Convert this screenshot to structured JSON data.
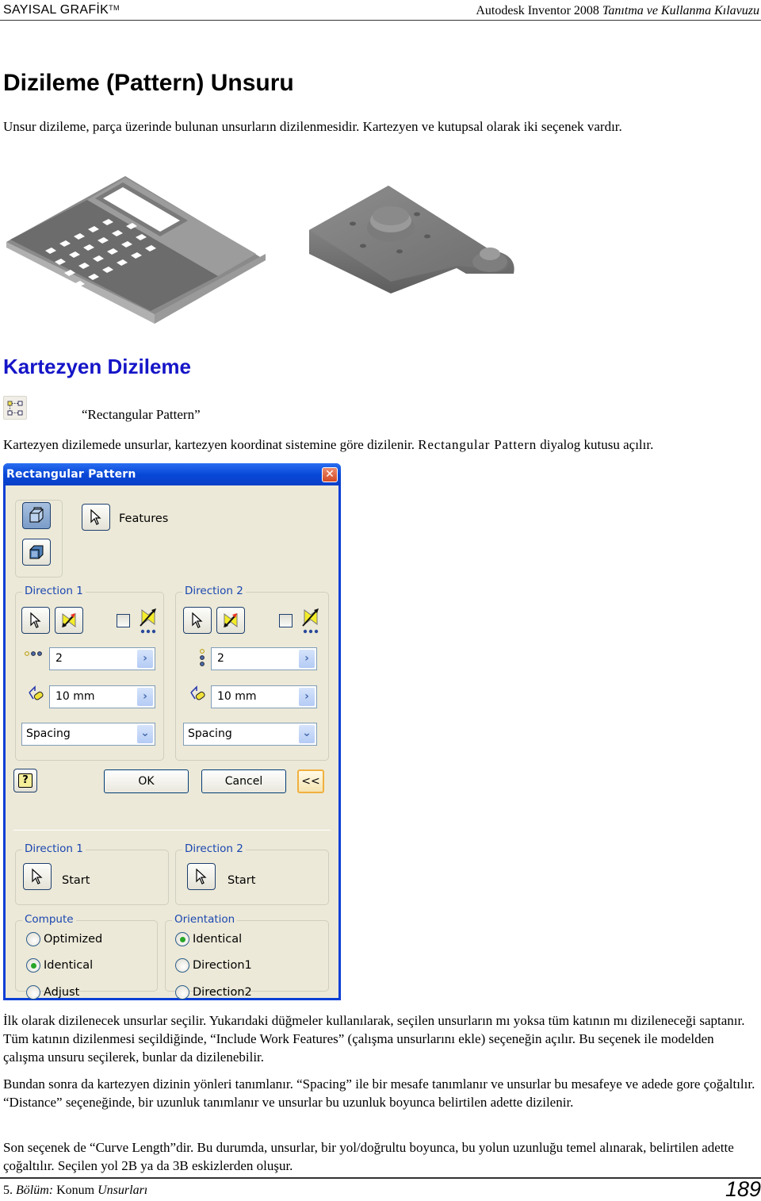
{
  "header": {
    "brand": "SAYISAL GRAFİK",
    "brand_tm": "TM",
    "book_prefix": "Autodesk Inventor 2008",
    "book_suffix": "Tanıtma ve Kullanma Kılavuzu"
  },
  "title": "Dizileme (Pattern) Unsuru",
  "intro": "Unsur dizileme, parça üzerinde bulunan unsurların dizilenmesidir. Kartezyen ve kutupsal olarak iki seçenek vardır.",
  "images": {
    "left": "calculator-pattern-model",
    "right": "plate-circular-pattern-model"
  },
  "section": {
    "heading": "Kartezyen Dizileme",
    "icon": "rectangular-pattern-icon",
    "caption": "“Rectangular Pattern”",
    "desc_before": "Kartezyen dizilemede unsurlar, kartezyen koordinat sistemine göre dizilenir. ",
    "desc_term": "Rectangular Pattern",
    "desc_after": " diyalog kutusu açılır."
  },
  "dialog": {
    "title": "Rectangular Pattern",
    "close": "✕",
    "features_label": "Features",
    "direction1": {
      "label": "Direction 1",
      "count": "2",
      "spacing": "10 mm",
      "method": "Spacing",
      "flip_checked": false
    },
    "direction2": {
      "label": "Direction 2",
      "count": "2",
      "spacing": "10 mm",
      "method": "Spacing",
      "flip_checked": false
    },
    "help": "?",
    "ok": "OK",
    "cancel": "Cancel",
    "more": "<<",
    "start1": {
      "label": "Direction 1",
      "start": "Start"
    },
    "start2": {
      "label": "Direction 2",
      "start": "Start"
    },
    "compute": {
      "label": "Compute",
      "options": [
        "Optimized",
        "Identical",
        "Adjust"
      ],
      "selected": "Identical"
    },
    "orientation": {
      "label": "Orientation",
      "options": [
        "Identical",
        "Direction1",
        "Direction2"
      ],
      "selected": "Identical"
    }
  },
  "paragraphs": [
    "İlk olarak dizilenecek unsurlar seçilir. Yukarıdaki düğmeler kullanılarak, seçilen unsurların mı yoksa tüm katının mı dizileneceği saptanır. Tüm katının dizilenmesi seçildiğinde, “Include Work Features” (çalışma unsurlarını ekle) seçeneğin açılır. Bu seçenek ile modelden çalışma unsuru seçilerek, bunlar da dizilenebilir.",
    "Bundan sonra da kartezyen dizinin yönleri tanımlanır. “Spacing” ile bir mesafe tanımlanır ve unsurlar bu mesafeye ve adede gore çoğaltılır. “Distance” seçeneğinde, bir uzunluk tanımlanır ve unsurlar bu uzunluk boyunca belirtilen adette dizilenir.",
    "Son seçenek de “Curve Length”dir. Bu durumda, unsurlar, bir yol/doğrultu boyunca, bu yolun uzunluğu temel alınarak, belirtilen adette çoğaltılır. Seçilen yol 2B ya da 3B eskizlerden oluşur."
  ],
  "footer": {
    "chapter_num": "5.",
    "chapter_word": "Bölüm:",
    "chapter_a": "Konum",
    "chapter_b": "Unsurları",
    "page": "189"
  }
}
